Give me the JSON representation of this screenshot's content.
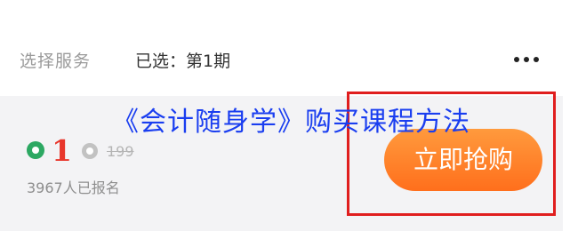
{
  "service_bar": {
    "label": "选择服务",
    "selected": "已选：第1期"
  },
  "overlay": {
    "title": "《会计随身学》购买课程方法"
  },
  "product": {
    "price": "1",
    "original_price": "199",
    "enrolled": "3967人已报名",
    "buy_label": "立即抢购"
  },
  "colors": {
    "price": "#e8362b",
    "buy_button": "#ff7a22",
    "highlight_frame": "#e01e1e",
    "overlay_title": "#1a3ef0"
  },
  "icons": {
    "more": "more-dots-icon",
    "price": "coin-icon",
    "original_price": "coin-icon"
  }
}
